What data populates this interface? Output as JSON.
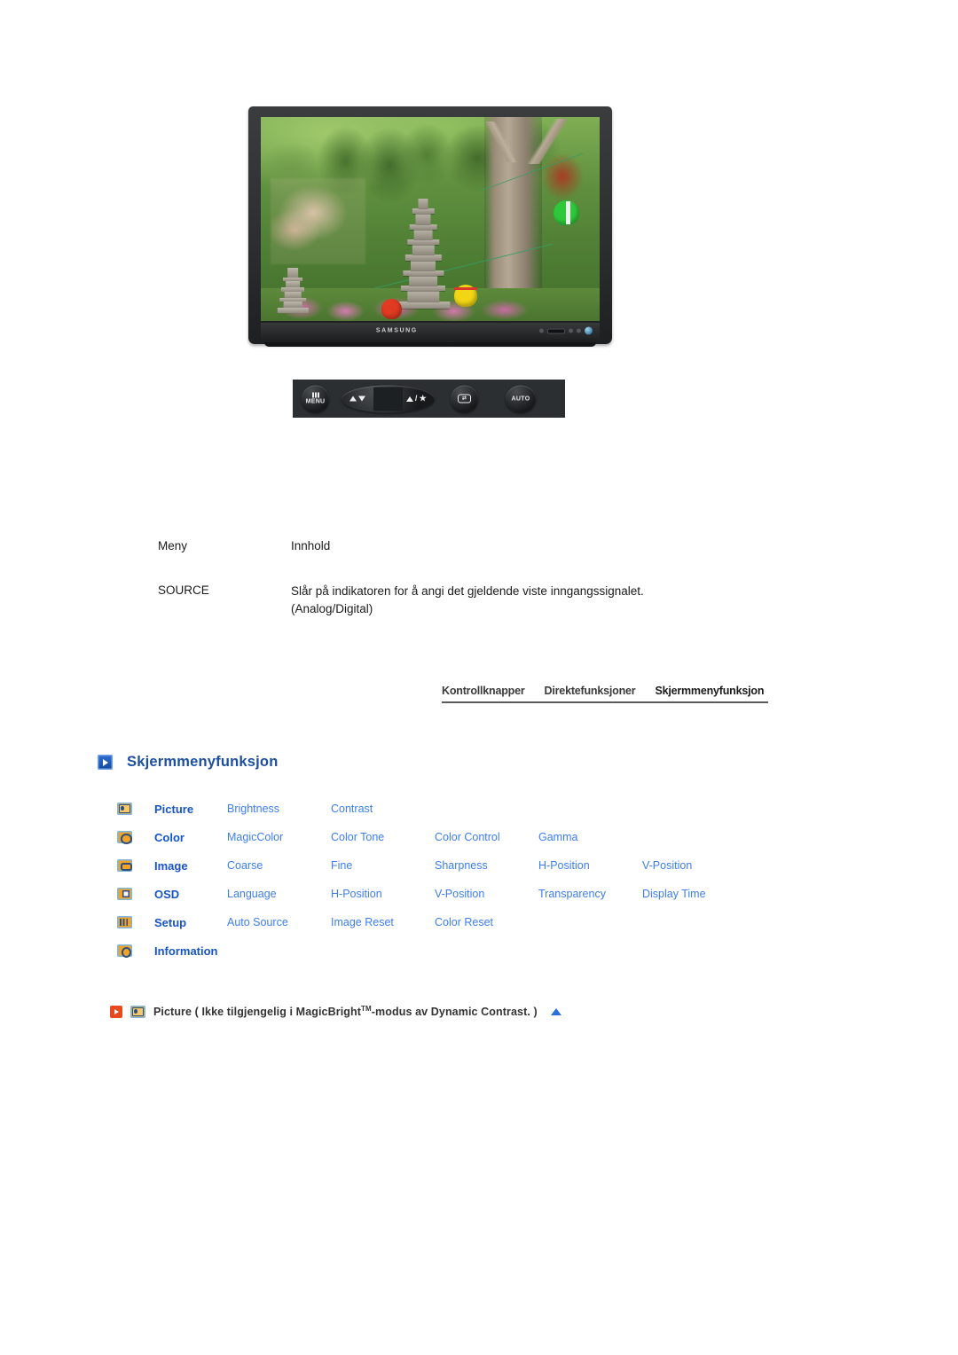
{
  "product": {
    "brand": "SAMSUNG",
    "monitor_alt": "samsung-lcd-monitor-front-view"
  },
  "control_buttons": [
    {
      "name": "menu-button",
      "label": "MENU"
    },
    {
      "name": "adjust-down-button",
      "label": ""
    },
    {
      "name": "brightness-button",
      "label": ""
    },
    {
      "name": "enter-button",
      "label": ""
    },
    {
      "name": "auto-button",
      "label": "AUTO"
    }
  ],
  "table": {
    "headers": {
      "menu": "Meny",
      "content": "Innhold"
    },
    "rows": [
      {
        "menu": "SOURCE",
        "content_line1": "Slår på indikatoren for å angi det gjeldende viste inngangssignalet.",
        "content_line2": "(Analog/Digital)"
      }
    ]
  },
  "tabs": [
    {
      "label": "Kontrollknapper",
      "active": false
    },
    {
      "label": "Direktefunksjoner",
      "active": false
    },
    {
      "label": "Skjermmenyfunksjon",
      "active": true
    }
  ],
  "section": {
    "title": "Skjermmenyfunksjon",
    "arrow_icon": "blue-play-arrow-icon",
    "title_color": "#1c4fa0"
  },
  "osd_menu": {
    "rows": [
      {
        "icon": "picture-icon",
        "category": "Picture",
        "items": [
          "Brightness",
          "Contrast"
        ]
      },
      {
        "icon": "color-icon",
        "category": "Color",
        "items": [
          "MagicColor",
          "Color Tone",
          "Color Control",
          "Gamma"
        ]
      },
      {
        "icon": "image-icon",
        "category": "Image",
        "items": [
          "Coarse",
          "Fine",
          "Sharpness",
          "H-Position",
          "V-Position"
        ]
      },
      {
        "icon": "osd-icon",
        "category": "OSD",
        "items": [
          "Language",
          "H-Position",
          "V-Position",
          "Transparency",
          "Display Time"
        ]
      },
      {
        "icon": "setup-icon",
        "category": "Setup",
        "items": [
          "Auto Source",
          "Image Reset",
          "Color Reset"
        ]
      },
      {
        "icon": "information-icon",
        "category": "Information",
        "items": []
      }
    ],
    "category_color": "#1654c8",
    "item_color": "#3d7ef0"
  },
  "footer_note": {
    "red_arrow_icon": "red-play-arrow-icon",
    "picture_icon": "picture-icon",
    "text_before_tm": "Picture ( Ikke tilgjengelig i MagicBright",
    "tm": "TM",
    "text_after_tm": "-modus av Dynamic Contrast. )",
    "up_arrow_icon": "blue-up-triangle-icon"
  }
}
